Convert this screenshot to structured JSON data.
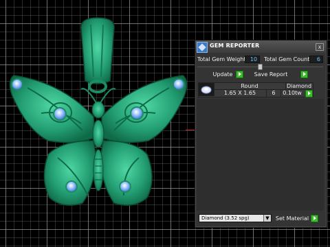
{
  "panel": {
    "title": "GEM REPORTER",
    "close": "x",
    "total_weight_label": "Total Gem Weight",
    "total_weight_value": "10",
    "total_count_label": "Total Gem Count",
    "total_count_value": "6",
    "update_label": "Update",
    "save_label": "Save Report",
    "table": {
      "headers": [
        "Round",
        "Diamond"
      ],
      "row": {
        "size": "1.65 X 1.65",
        "count": "6",
        "weight": "0.10tw"
      }
    },
    "material": {
      "selected": "Diamond    (3.52 spg)",
      "set_label": "Set Material"
    }
  },
  "icons": {
    "app": "gem-reporter-app-icon",
    "close": "close-icon",
    "go": "green-arrow-icon",
    "dropdown": "chevron-down-icon",
    "gem": "round-gem-icon"
  },
  "colors": {
    "model": "#2aa97c",
    "value_text": "#5fc8ff",
    "go_button": "#3dbb2c",
    "panel_bg": "#343434"
  }
}
